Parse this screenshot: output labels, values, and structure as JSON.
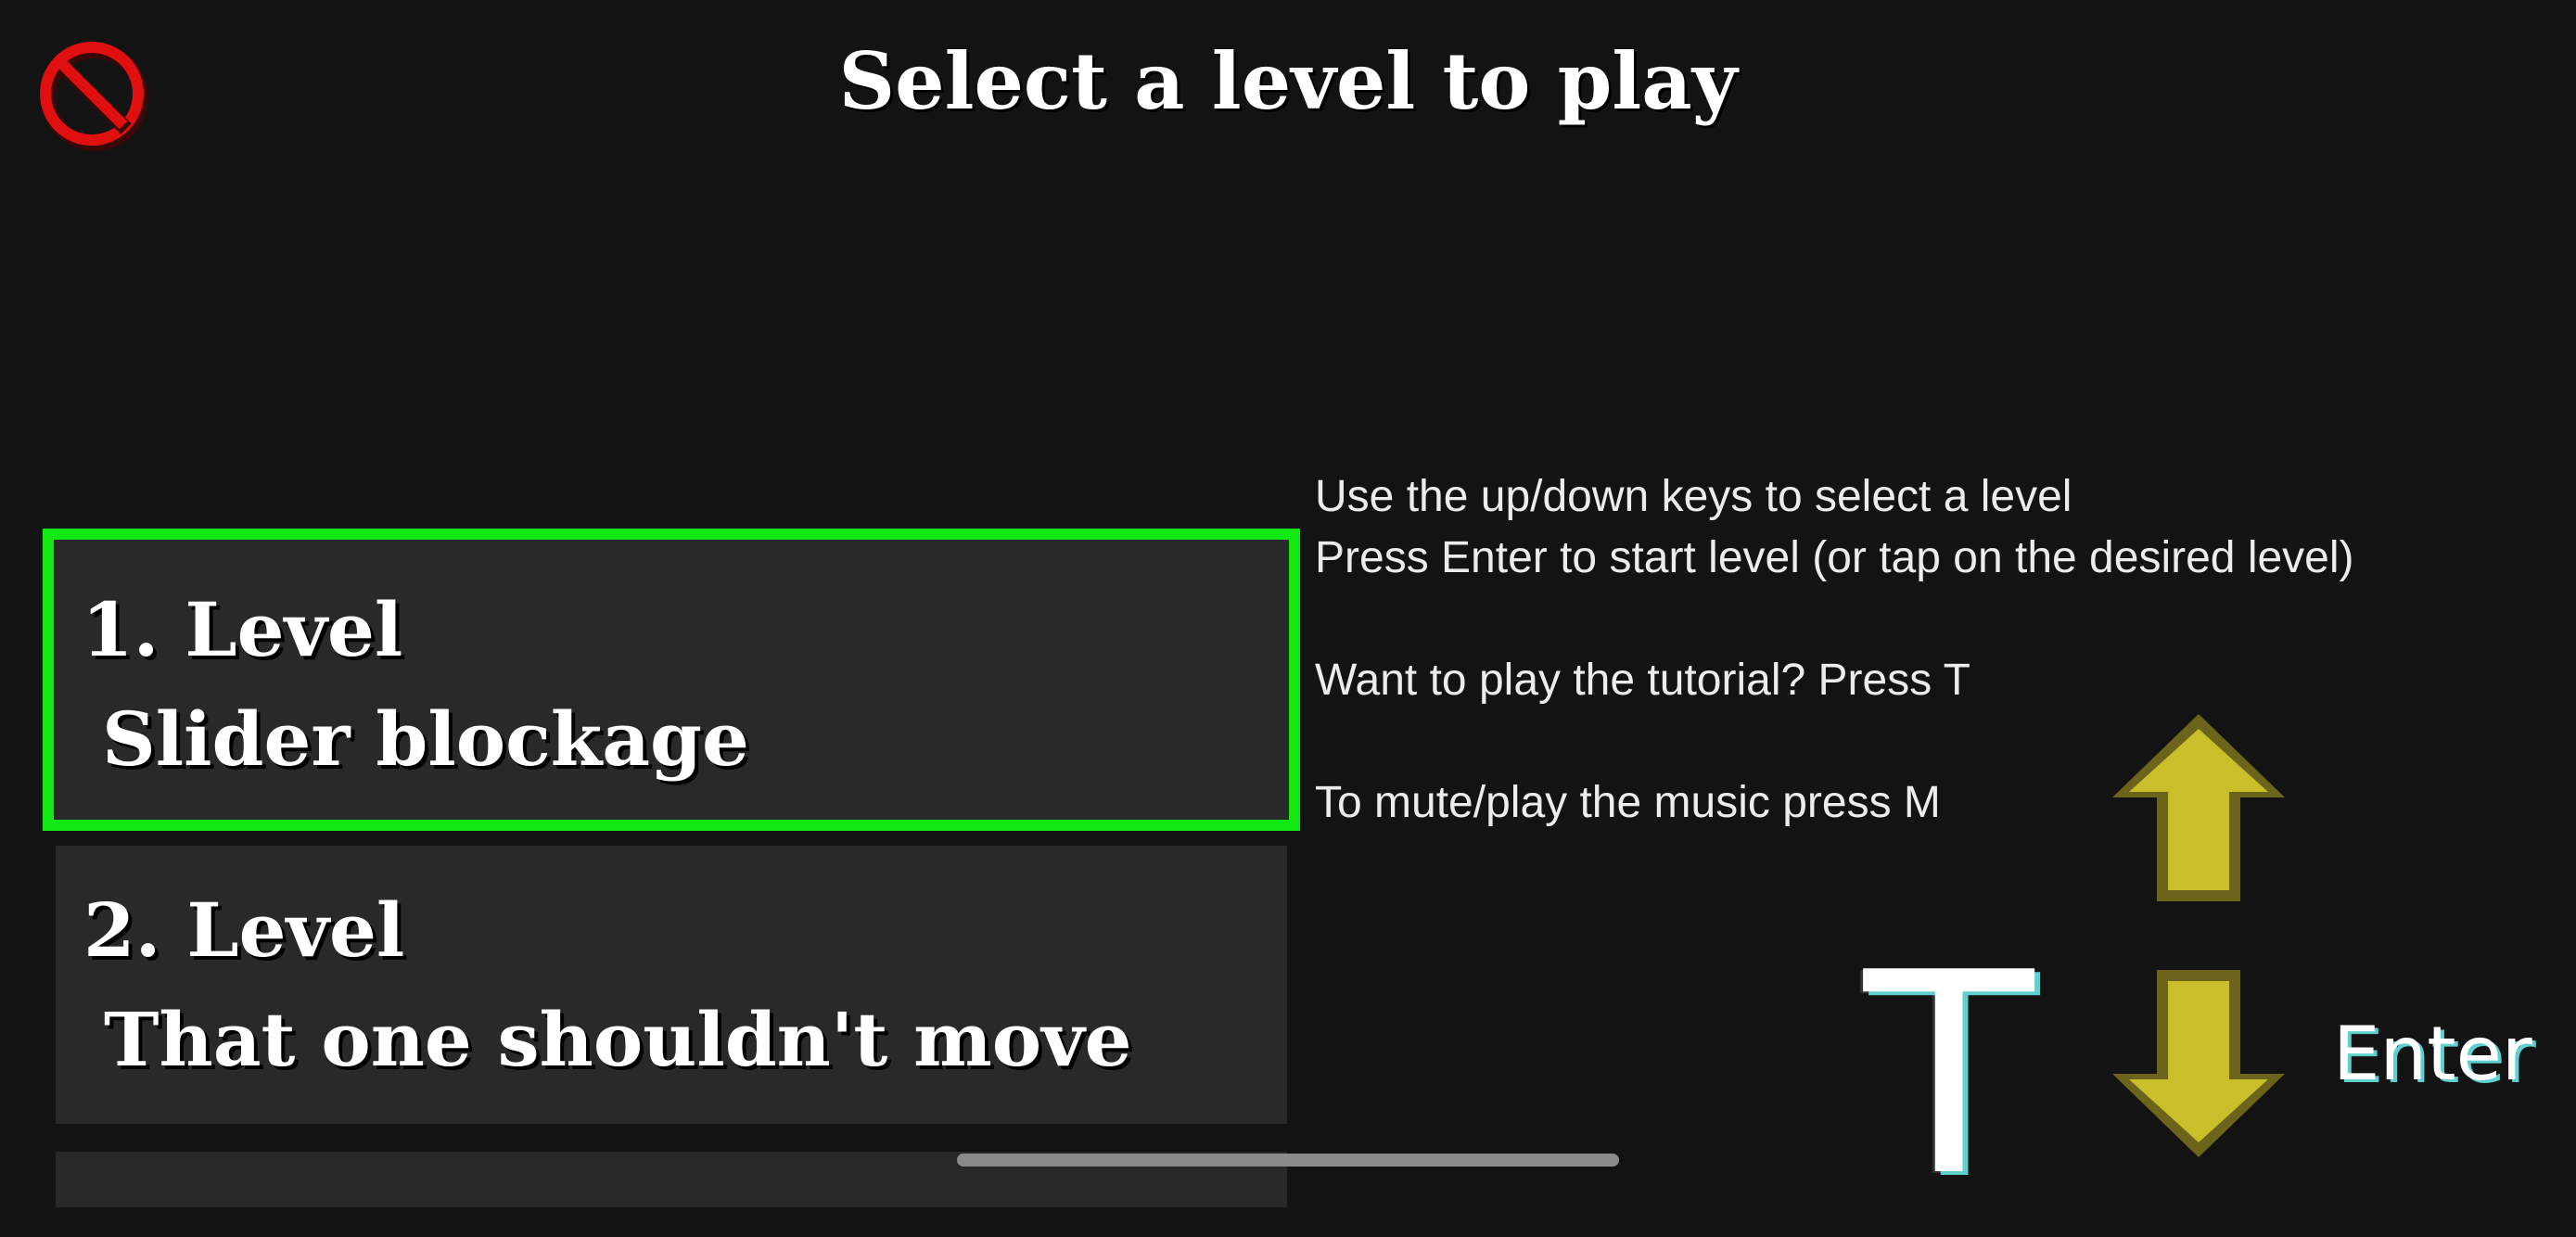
{
  "header": {
    "title": "Select a level to play",
    "mute_icon": "no-sound-icon"
  },
  "levels": [
    {
      "number": "1. Level",
      "name": "Slider blockage",
      "selected": true
    },
    {
      "number": "2. Level",
      "name": "That one shouldn't move",
      "selected": false
    }
  ],
  "instructions": {
    "line1": "Use the up/down keys to select a level",
    "line2": "Press Enter to start level (or tap on the desired level)",
    "line3": "Want to play the tutorial? Press T",
    "line4": "To mute/play the music press M"
  },
  "key_hints": {
    "tutorial_key": "T",
    "up_icon": "arrow-up-icon",
    "down_icon": "arrow-down-icon",
    "enter_label": "Enter"
  },
  "colors": {
    "background": "#131313",
    "selected_border": "#12e812",
    "card": "#292929",
    "arrow": "#c8bf2a",
    "mute_icon": "#e01010"
  }
}
